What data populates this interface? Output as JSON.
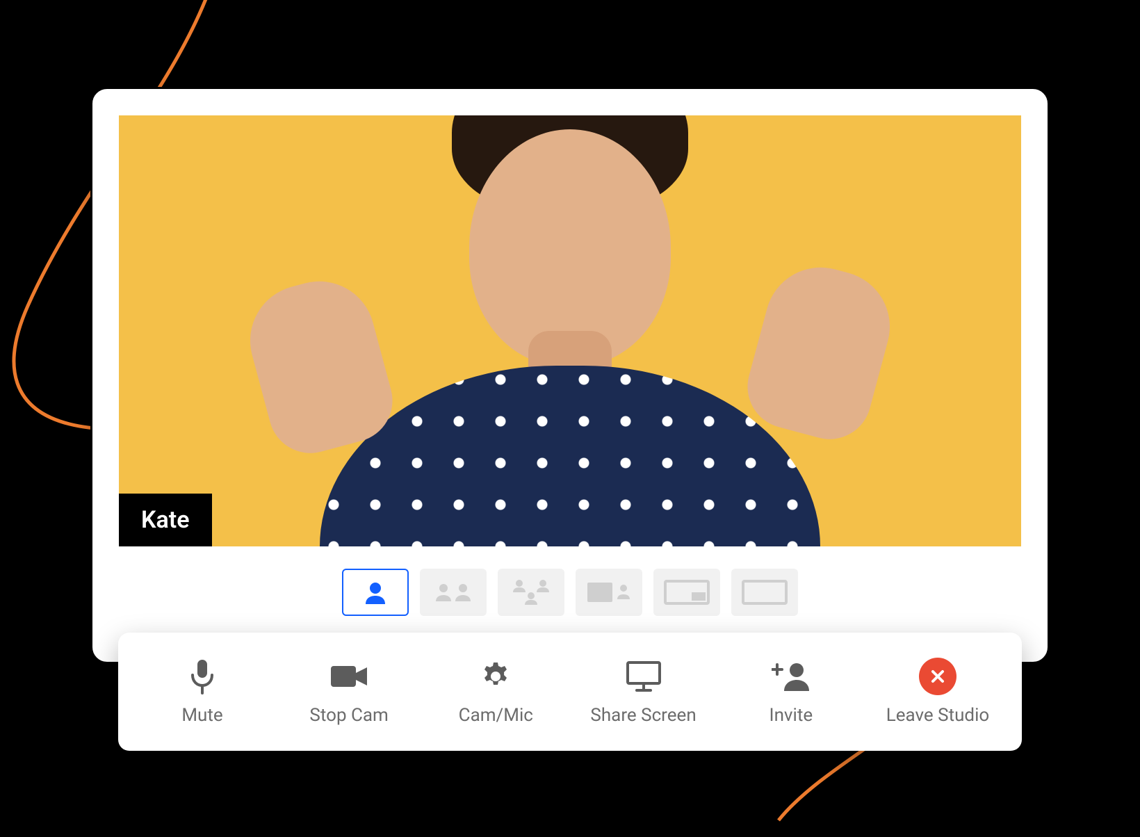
{
  "participant": {
    "name": "Kate"
  },
  "layouts": [
    {
      "id": "single",
      "active": true
    },
    {
      "id": "two-up",
      "active": false
    },
    {
      "id": "grid-3",
      "active": false
    },
    {
      "id": "feature",
      "active": false
    },
    {
      "id": "pip",
      "active": false
    },
    {
      "id": "screen",
      "active": false
    }
  ],
  "toolbar": {
    "mute": {
      "label": "Mute"
    },
    "cam": {
      "label": "Stop Cam"
    },
    "device": {
      "label": "Cam/Mic"
    },
    "share": {
      "label": "Share Screen"
    },
    "invite": {
      "label": "Invite"
    },
    "leave": {
      "label": "Leave Studio"
    }
  },
  "colors": {
    "accent": "#1360ff",
    "video_bg": "#f4c049",
    "leave": "#ea4a33",
    "swirl": "#ed7b2d"
  }
}
